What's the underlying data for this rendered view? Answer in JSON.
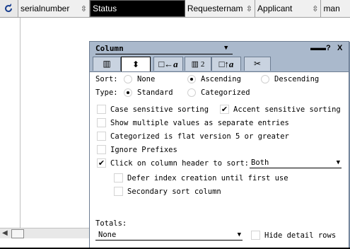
{
  "view": {
    "columns": [
      {
        "label": "serialnumber",
        "sort_icon": "sort-updown-icon",
        "selected": false
      },
      {
        "label": "Status",
        "sort_icon": "",
        "selected": true
      },
      {
        "label": "Requesternam",
        "sort_icon": "sort-updown-icon",
        "selected": false
      },
      {
        "label": "Applicant",
        "sort_icon": "sort-updown-icon",
        "selected": false
      },
      {
        "label": "man",
        "sort_icon": "",
        "selected": false
      }
    ],
    "sort_glyph": "⇳"
  },
  "panel": {
    "title": "Column",
    "controls": {
      "menu": "▬▬",
      "help": "?",
      "close": "X"
    },
    "tabs": [
      {
        "name": "column-info-tab",
        "glyph": "▥",
        "active": false
      },
      {
        "name": "sorting-tab",
        "glyph": "⬍",
        "active": true
      },
      {
        "name": "font-tab",
        "glyph": "□←a",
        "active": false
      },
      {
        "name": "numbers-tab",
        "glyph": "▥ 2",
        "active": false
      },
      {
        "name": "title-font-tab",
        "glyph": "□↑a",
        "active": false
      },
      {
        "name": "advanced-tab",
        "glyph": "✂",
        "active": false
      }
    ],
    "sort": {
      "label": "Sort:",
      "options": [
        "None",
        "Ascending",
        "Descending"
      ],
      "selected": "Ascending"
    },
    "type": {
      "label": "Type:",
      "options": [
        "Standard",
        "Categorized"
      ],
      "selected": "Standard"
    },
    "checks": [
      {
        "label": "Case sensitive sorting",
        "checked": false
      },
      {
        "label": "Accent sensitive sorting",
        "checked": true
      },
      {
        "label": "Show multiple values as separate entries",
        "checked": false
      },
      {
        "label": "Categorized is flat version 5 or greater",
        "checked": false
      },
      {
        "label": "Ignore Prefixes",
        "checked": false
      },
      {
        "label": "Click on column header to sort:",
        "checked": true
      },
      {
        "label": "Defer index creation until first use",
        "checked": false
      },
      {
        "label": "Secondary sort column",
        "checked": false
      },
      {
        "label": "Hide detail rows",
        "checked": false
      }
    ],
    "click_sort_value": "Both",
    "totals": {
      "label": "Totals:",
      "value": "None"
    },
    "check_glyph": "✔"
  }
}
